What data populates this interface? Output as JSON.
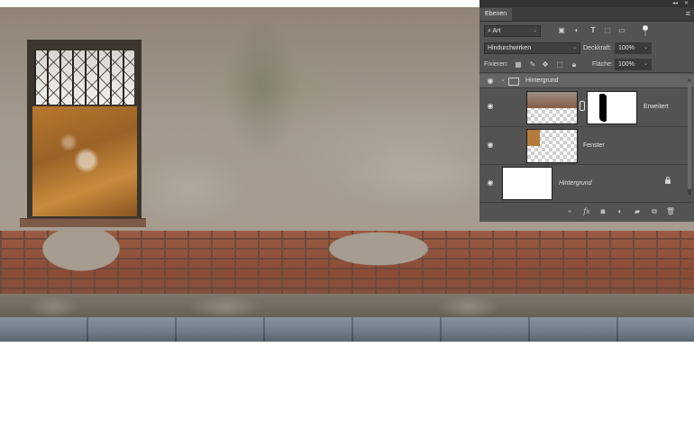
{
  "panel": {
    "tab_label": "Ebenen",
    "filter": {
      "label": "Art",
      "icons": [
        "image-filter-icon",
        "adjustment-filter-icon",
        "type-filter-icon",
        "shape-filter-icon",
        "smart-object-filter-icon",
        "filter-toggle"
      ]
    },
    "blend_mode": "Hindurchwirken",
    "opacity_label": "Deckkraft:",
    "opacity_value": "100%",
    "lock_label": "Fixieren:",
    "fill_label": "Fläche:",
    "fill_value": "100%",
    "layers": [
      {
        "name": "Hintergrund",
        "kind": "group",
        "visible": true
      },
      {
        "name": "Erweitert",
        "kind": "layer-with-mask",
        "visible": true
      },
      {
        "name": "Fenster",
        "kind": "layer",
        "visible": true
      },
      {
        "name": "Hintergrund",
        "kind": "background",
        "visible": true,
        "locked": true
      }
    ],
    "footer_icons": [
      "link-layers-icon",
      "fx-icon",
      "add-mask-icon",
      "adjustment-layer-icon",
      "new-group-icon",
      "new-layer-icon",
      "delete-layer-icon"
    ],
    "fx_label": "fx"
  },
  "colors": {
    "panel_bg": "#535353",
    "selected_row": "#646464"
  }
}
